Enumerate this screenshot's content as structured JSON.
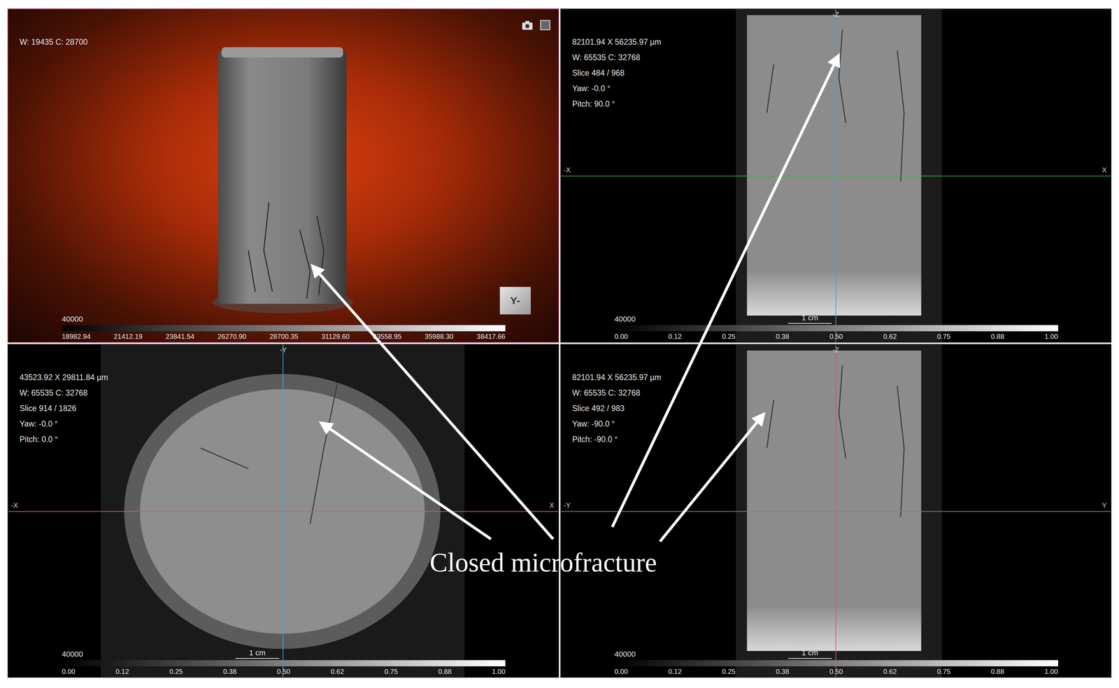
{
  "figure": {
    "annotation": "Closed microfracture"
  },
  "viewports": [
    {
      "kind": "volume",
      "info": [
        "W: 19435 C: 28700"
      ],
      "cube_label": "Y-",
      "colorbar": {
        "max": "40000",
        "ticks": [
          "18982.94",
          "21412.19",
          "23841.54",
          "26270.90",
          "28700.35",
          "31129.60",
          "33558.95",
          "35988.30",
          "38417.66"
        ],
        "scale": ""
      }
    },
    {
      "kind": "slice-vertical",
      "info": [
        "82101.94 X 56235.97 µm",
        "W: 65535 C: 32768",
        "Slice 484 / 968",
        "Yaw: -0.0 °",
        "Pitch: 90.0 °"
      ],
      "axes": {
        "top": "-Z",
        "left": "-X",
        "right": "X"
      },
      "h_line_color": "#3fae49",
      "v_line_color": "#4a9fe0",
      "colorbar": {
        "max": "40000",
        "ticks": [
          "0.00",
          "0.12",
          "0.25",
          "0.38",
          "0.50",
          "0.62",
          "0.75",
          "0.88",
          "1.00"
        ],
        "scale": "1 cm"
      }
    },
    {
      "kind": "slice-axial",
      "info": [
        "43523.92 X 29811.84 µm",
        "W: 65535 C: 32768",
        "Slice 914 / 1826",
        "Yaw: -0.0 °",
        "Pitch: 0.0 °"
      ],
      "axes": {
        "top": "-Y",
        "left": "-X",
        "right": "X"
      },
      "h_line_color": "#e0506a",
      "v_line_color": "#4a9fe0",
      "colorbar": {
        "max": "40000",
        "ticks": [
          "0.00",
          "0.12",
          "0.25",
          "0.38",
          "0.50",
          "0.62",
          "0.75",
          "0.88",
          "1.00"
        ],
        "scale": "1 cm"
      }
    },
    {
      "kind": "slice-vertical",
      "info": [
        "82101.94 X 56235.97 µm",
        "W: 65535 C: 32768",
        "Slice 492 / 983",
        "Yaw: -90.0 °",
        "Pitch: -90.0 °"
      ],
      "axes": {
        "top": "-Z",
        "left": "-Y",
        "right": "Y"
      },
      "h_line_color": "#3fae49",
      "v_line_color": "#e0506a",
      "colorbar": {
        "max": "40000",
        "ticks": [
          "0.00",
          "0.12",
          "0.25",
          "0.38",
          "0.50",
          "0.62",
          "0.75",
          "0.88",
          "1.00"
        ],
        "scale": "1 cm"
      }
    }
  ]
}
